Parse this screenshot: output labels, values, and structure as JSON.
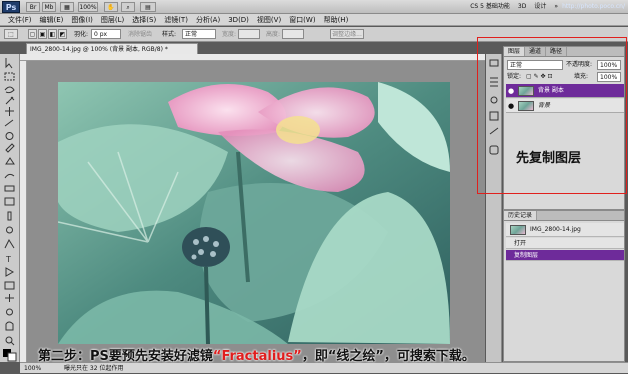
{
  "app": {
    "logo": "Ps",
    "version_label": "CS 5 基础功能",
    "mode_3d": "3D",
    "mode_design": "设计",
    "mode_more": "»",
    "watermark": "http://photo.poco.cn/"
  },
  "menu": [
    "文件(F)",
    "编辑(E)",
    "图像(I)",
    "图层(L)",
    "选择(S)",
    "滤镜(T)",
    "分析(A)",
    "3D(D)",
    "视图(V)",
    "窗口(W)",
    "帮助(H)"
  ],
  "options": {
    "feather_label": "羽化:",
    "feather_value": "0 px",
    "antialias_label": "消除锯齿",
    "style_label": "样式:",
    "style_value": "正常",
    "width_label": "宽度:",
    "height_label": "高度:",
    "refine_edge": "调整边缘..."
  },
  "document": {
    "tab_title": "IMG_2800-14.jpg @ 100% (背景 副本, RGB/8) *"
  },
  "layers_panel": {
    "tabs": [
      "图层",
      "通道",
      "路径"
    ],
    "blend_mode": "正常",
    "opacity_label": "不透明度:",
    "opacity_value": "100%",
    "lock_label": "锁定:",
    "fill_label": "填充:",
    "fill_value": "100%",
    "layers": [
      {
        "name": "背景 副本",
        "selected": true
      },
      {
        "name": "背景",
        "selected": false
      }
    ]
  },
  "history_panel": {
    "title": "历史记录",
    "snapshot": "IMG_2800-14.jpg",
    "items": [
      {
        "label": "打开",
        "selected": false
      },
      {
        "label": "复制图层",
        "selected": true
      }
    ]
  },
  "annotation": {
    "layers_note": "先复制图层"
  },
  "caption": {
    "part1": "第二步：PS要预先安装好滤镜",
    "highlight": "“Fractalius”",
    "part2": "，即“线之绘”，可搜索下载。"
  },
  "status": {
    "zoom": "100%",
    "info": "曝光只在 32 位起作用"
  },
  "colors": {
    "accent_selection": "#6e2b9a",
    "annotation_red": "#e0201d"
  }
}
